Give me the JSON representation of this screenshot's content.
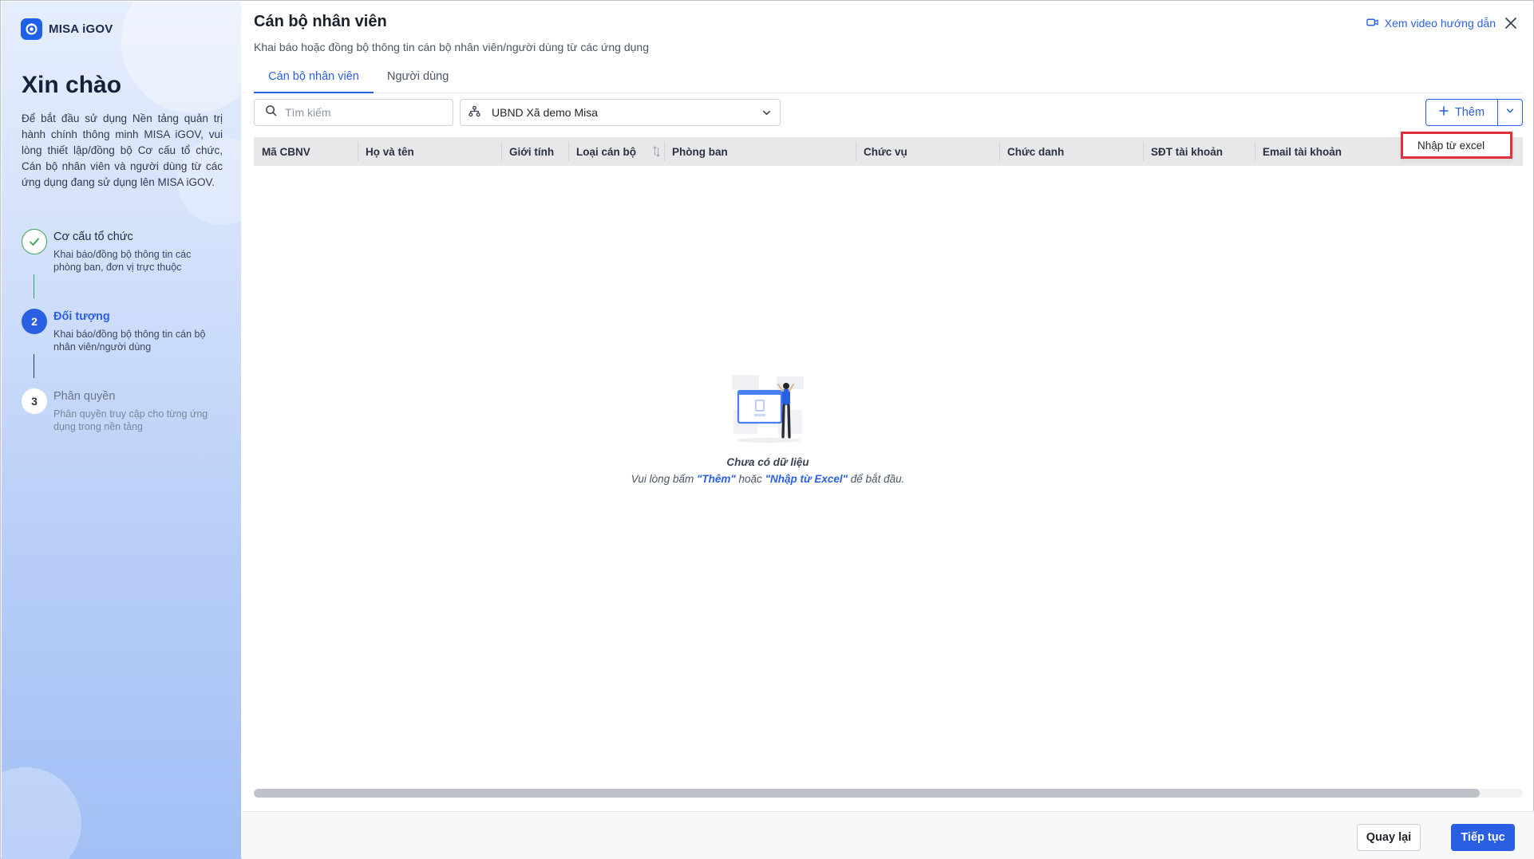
{
  "app": {
    "name": "MISA iGOV"
  },
  "sidebar": {
    "greeting": "Xin chào",
    "intro": "Để bắt đầu sử dụng Nền tảng quản trị hành chính thông minh MISA iGOV, vui lòng thiết lập/đồng bộ Cơ cấu tổ chức, Cán bộ nhân viên và người dùng từ các ứng dụng đang sử dụng lên MISA iGOV.",
    "steps": [
      {
        "number": "",
        "state": "done",
        "title": "Cơ cấu tổ chức",
        "desc": "Khai báo/đồng bộ thông tin các phòng ban, đơn vị trực thuộc"
      },
      {
        "number": "2",
        "state": "active",
        "title": "Đối tượng",
        "desc": "Khai báo/đồng bộ thông tin cán bộ nhân viên/người dùng"
      },
      {
        "number": "3",
        "state": "todo",
        "title": "Phân quyền",
        "desc": "Phân quyền truy cập cho từng ứng dụng trong nền tảng"
      }
    ]
  },
  "header": {
    "title": "Cán bộ nhân viên",
    "subtitle": "Khai báo hoặc đồng bộ thông tin cán bộ nhân viên/người dùng từ các ứng dụng",
    "help_link": "Xem video hướng dẫn"
  },
  "tabs": [
    {
      "label": "Cán bộ nhân viên",
      "active": true
    },
    {
      "label": "Người dùng",
      "active": false
    }
  ],
  "toolbar": {
    "search_placeholder": "Tìm kiếm",
    "org_selected": "UBND Xã demo Misa",
    "add_label": "Thêm",
    "dropdown_item": "Nhập từ excel"
  },
  "table": {
    "columns": [
      "Mã CBNV",
      "Họ và tên",
      "Giới tính",
      "Loại cán bộ",
      "Phòng ban",
      "Chức vụ",
      "Chức danh",
      "SĐT tài khoản",
      "Email tài khoản"
    ],
    "rows": []
  },
  "empty_state": {
    "title": "Chưa có dữ liệu",
    "msg_prefix": "Vui lòng bấm ",
    "link_add": "\"Thêm\"",
    "msg_middle": " hoặc ",
    "link_import": "\"Nhập từ Excel\"",
    "msg_suffix": " để bắt đầu."
  },
  "footer": {
    "back_label": "Quay lại",
    "next_label": "Tiếp tục"
  },
  "colors": {
    "primary": "#2b5fe3",
    "success": "#3aa35b",
    "highlight_border": "#e0303a"
  }
}
